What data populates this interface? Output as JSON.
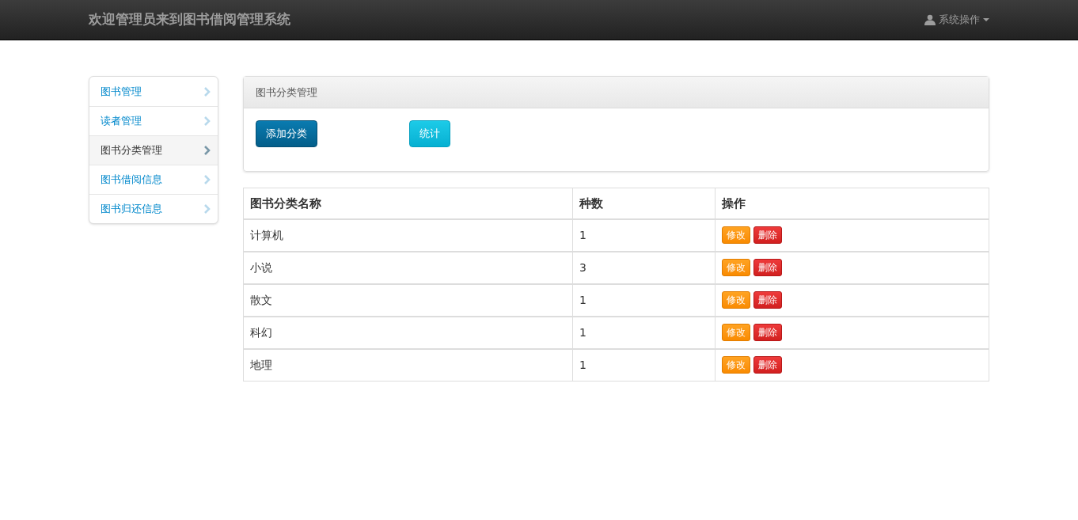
{
  "navbar": {
    "brand": "欢迎管理员来到图书借阅管理系统",
    "menu": {
      "label": "系统操作"
    }
  },
  "sidebar": {
    "items": [
      {
        "label": "图书管理",
        "selected": false
      },
      {
        "label": "读者管理",
        "selected": false
      },
      {
        "label": "图书分类管理",
        "selected": true
      },
      {
        "label": "图书借阅信息",
        "selected": false
      },
      {
        "label": "图书归还信息",
        "selected": false
      }
    ]
  },
  "panel": {
    "title": "图书分类管理",
    "buttons": [
      {
        "label": "添加分类",
        "kind": "primary"
      },
      {
        "label": "统计",
        "kind": "info"
      }
    ]
  },
  "table": {
    "columns": [
      "图书分类名称",
      "种数",
      "操作"
    ],
    "rows": [
      {
        "name": "计算机",
        "count": "1",
        "actions": [
          "修改",
          "删除"
        ]
      },
      {
        "name": "小说",
        "count": "3",
        "actions": [
          "修改",
          "删除"
        ]
      },
      {
        "name": "散文",
        "count": "1",
        "actions": [
          "修改",
          "删除"
        ]
      },
      {
        "name": "科幻",
        "count": "1",
        "actions": [
          "修改",
          "删除"
        ]
      },
      {
        "name": "地理",
        "count": "1",
        "actions": [
          "修改",
          "删除"
        ]
      }
    ]
  }
}
